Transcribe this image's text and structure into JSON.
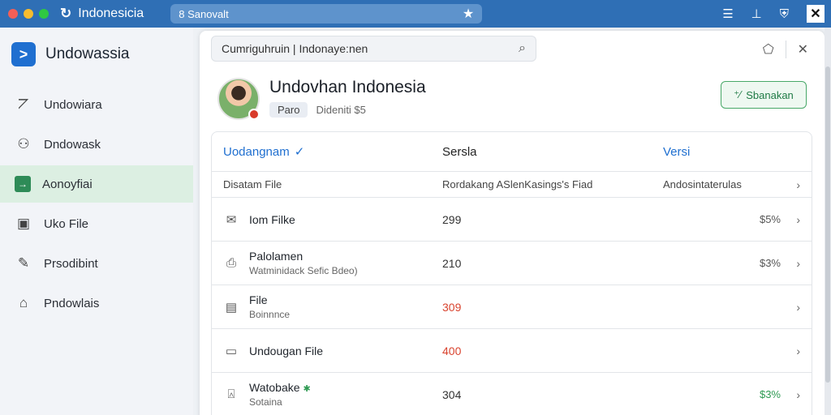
{
  "titlebar": {
    "app_title": "Indonesicia",
    "url": "8 Sanovalt",
    "icons": [
      "list-icon",
      "pin-icon",
      "shield-icon",
      "brand-x-icon"
    ]
  },
  "sidebar": {
    "brand": "Undowassia",
    "items": [
      {
        "label": "Undowiara",
        "icon": "chart-icon",
        "active": false
      },
      {
        "label": "Dndowask",
        "icon": "user-icon",
        "active": false
      },
      {
        "label": "Aonoyfiai",
        "icon": "arrow-icon",
        "active": true
      },
      {
        "label": "Uko File",
        "icon": "image-icon",
        "active": false
      },
      {
        "label": "Prsodibint",
        "icon": "pen-icon",
        "active": false
      },
      {
        "label": "Pndowlais",
        "icon": "building-icon",
        "active": false
      }
    ]
  },
  "panel": {
    "search_text": "Cumriguhruin  |  Indonaye:nen",
    "profile_name": "Undovhan Indonesia",
    "profile_tag": "Paro",
    "profile_meta": "Dideniti $5",
    "action_label": "Sbanakan"
  },
  "table": {
    "headers": [
      "Uodangnam",
      "Sersla",
      "Versi"
    ],
    "subhead": [
      "Disatam File",
      "Rordakang ASlenKasings's Fiad",
      "Andosintaterulas"
    ],
    "rows": [
      {
        "icon": "mail-icon",
        "title": "Iom Filke",
        "sub": "",
        "value": "299",
        "extra": "$5%",
        "value_color": "normal",
        "extra_color": "normal"
      },
      {
        "icon": "doc-icon",
        "title": "Palolamen",
        "sub": "Watminidack Sefic Bdeo)",
        "value": "210",
        "extra": "$3%",
        "value_color": "normal",
        "extra_color": "normal"
      },
      {
        "icon": "calendar-icon",
        "title": "File",
        "sub": "Boinnnce",
        "value": "309",
        "extra": "",
        "value_color": "red",
        "extra_color": "normal"
      },
      {
        "icon": "archive-icon",
        "title": "Undougan File",
        "sub": "",
        "value": "400",
        "extra": "",
        "value_color": "red",
        "extra_color": "normal"
      },
      {
        "icon": "lock-icon",
        "title": "Watobake",
        "sub": "Sotaina",
        "value": "304",
        "extra": "$3%",
        "value_color": "normal",
        "extra_color": "green"
      }
    ]
  },
  "colors": {
    "titlebar": "#2f6fb5",
    "accent_blue": "#1f6fd0",
    "accent_green": "#2e9a52",
    "accent_red": "#d9442f"
  }
}
